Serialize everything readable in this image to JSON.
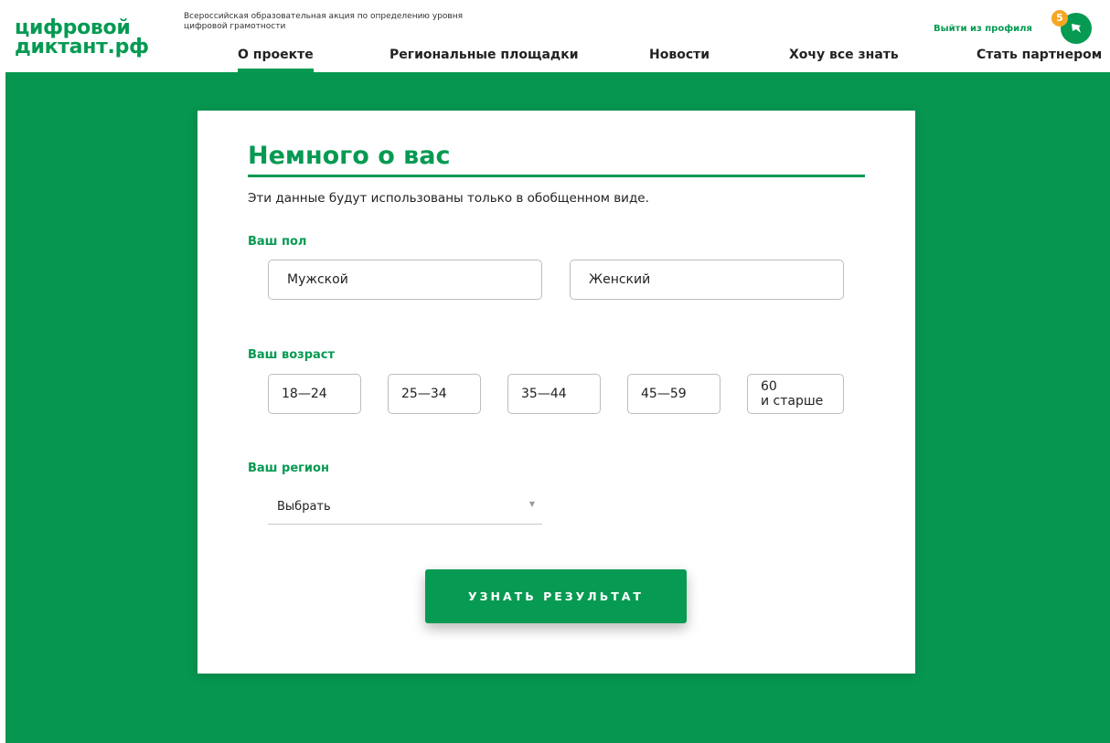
{
  "header": {
    "logo_line1": "цифровой",
    "logo_line2": "диктант.рф",
    "tagline": "Всероссийская образовательная акция по определению уровня цифровой грамотности",
    "logout": "Выйти из профиля",
    "notifications": "5"
  },
  "nav": {
    "items": [
      "О проекте",
      "Региональные площадки",
      "Новости",
      "Хочу все знать",
      "Стать партнером"
    ],
    "active": "О проекте"
  },
  "form": {
    "title": "Немного о вас",
    "subtitle": "Эти данные будут использованы только в обобщенном виде.",
    "gender_label": "Ваш пол",
    "gender_options": [
      "Мужской",
      "Женский"
    ],
    "age_label": "Ваш возраст",
    "age_options": [
      "18—24",
      "25—34",
      "35—44",
      "45—59",
      "60\nи старше"
    ],
    "region_label": "Ваш регион",
    "region_value": "Выбрать",
    "submit": "УЗНАТЬ РЕЗУЛЬТАТ"
  },
  "colors": {
    "brand_green": "#069a52",
    "background_green": "#069650",
    "badge_orange": "#f5a623"
  }
}
